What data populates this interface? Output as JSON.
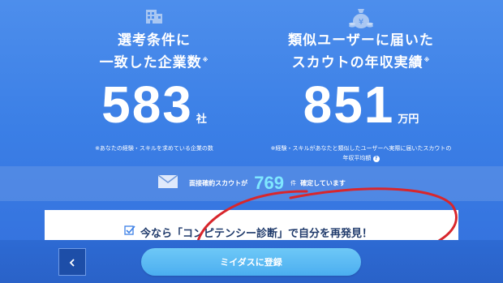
{
  "left_stat": {
    "icon": "building-icon",
    "title_line1": "選考条件に",
    "title_line2": "一致した企業数",
    "mark": "※",
    "value": "583",
    "unit": "社",
    "note": "※あなたの経験・スキルを求めている企業の数"
  },
  "right_stat": {
    "icon": "money-bag-icon",
    "title_line1": "類似ユーザーに届いた",
    "title_line2": "スカウトの年収実績",
    "mark": "※",
    "value": "851",
    "unit": "万円",
    "note_line1": "※経験・スキルがあなたと類似したユーザーへ実際に届いたスカウトの",
    "note_line2": "年収平均額",
    "help": "?"
  },
  "interview_band": {
    "icon": "mail-icon",
    "text_before": "面接確約スカウトが",
    "value": "769",
    "unit": "件",
    "text_after": "確定しています"
  },
  "banner": {
    "icon": "check-icon",
    "text": "今なら「コンピテンシー診断」で自分を再発見！"
  },
  "footer": {
    "back_icon": "chevron-left-icon",
    "register_label": "ミイダスに登録"
  },
  "colors": {
    "accent_number": "#7fe7ff",
    "annotation_circle": "#d8262c",
    "button": "#4baef0"
  }
}
